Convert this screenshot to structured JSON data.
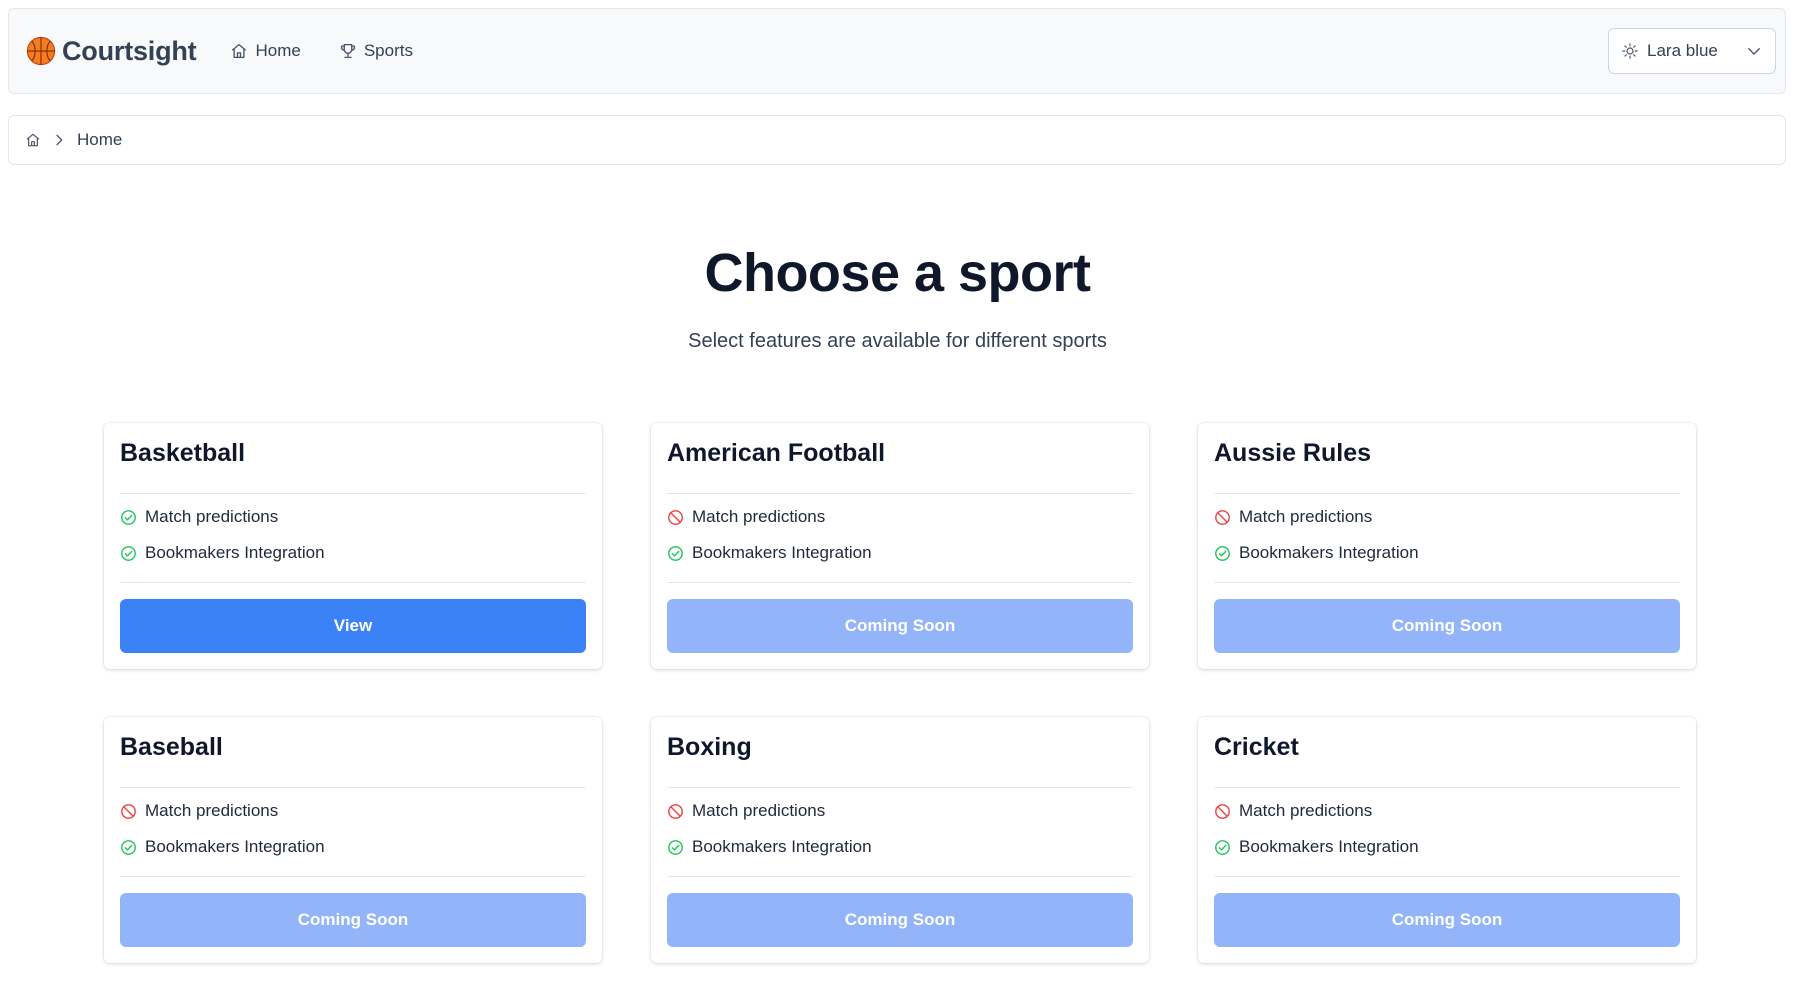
{
  "app": {
    "name": "Courtsight"
  },
  "nav": {
    "home": "Home",
    "sports": "Sports"
  },
  "theme": {
    "selected": "Lara blue"
  },
  "breadcrumb": {
    "current": "Home"
  },
  "page": {
    "title": "Choose a sport",
    "subtitle": "Select features are available for different sports"
  },
  "feature_labels": {
    "predictions": "Match predictions",
    "bookmakers": "Bookmakers Integration"
  },
  "colors": {
    "accent": "#3b82f6",
    "accent_disabled": "#93b4f8",
    "available": "#22c55e",
    "unavailable": "#ef4444"
  },
  "sports": [
    {
      "name": "Basketball",
      "predictions": "available",
      "bookmakers": "available",
      "button": "View",
      "enabled": true
    },
    {
      "name": "American Football",
      "predictions": "unavailable",
      "bookmakers": "available",
      "button": "Coming Soon",
      "enabled": false
    },
    {
      "name": "Aussie Rules",
      "predictions": "unavailable",
      "bookmakers": "available",
      "button": "Coming Soon",
      "enabled": false
    },
    {
      "name": "Baseball",
      "predictions": "unavailable",
      "bookmakers": "available",
      "button": "Coming Soon",
      "enabled": false
    },
    {
      "name": "Boxing",
      "predictions": "unavailable",
      "bookmakers": "available",
      "button": "Coming Soon",
      "enabled": false
    },
    {
      "name": "Cricket",
      "predictions": "unavailable",
      "bookmakers": "available",
      "button": "Coming Soon",
      "enabled": false
    }
  ]
}
